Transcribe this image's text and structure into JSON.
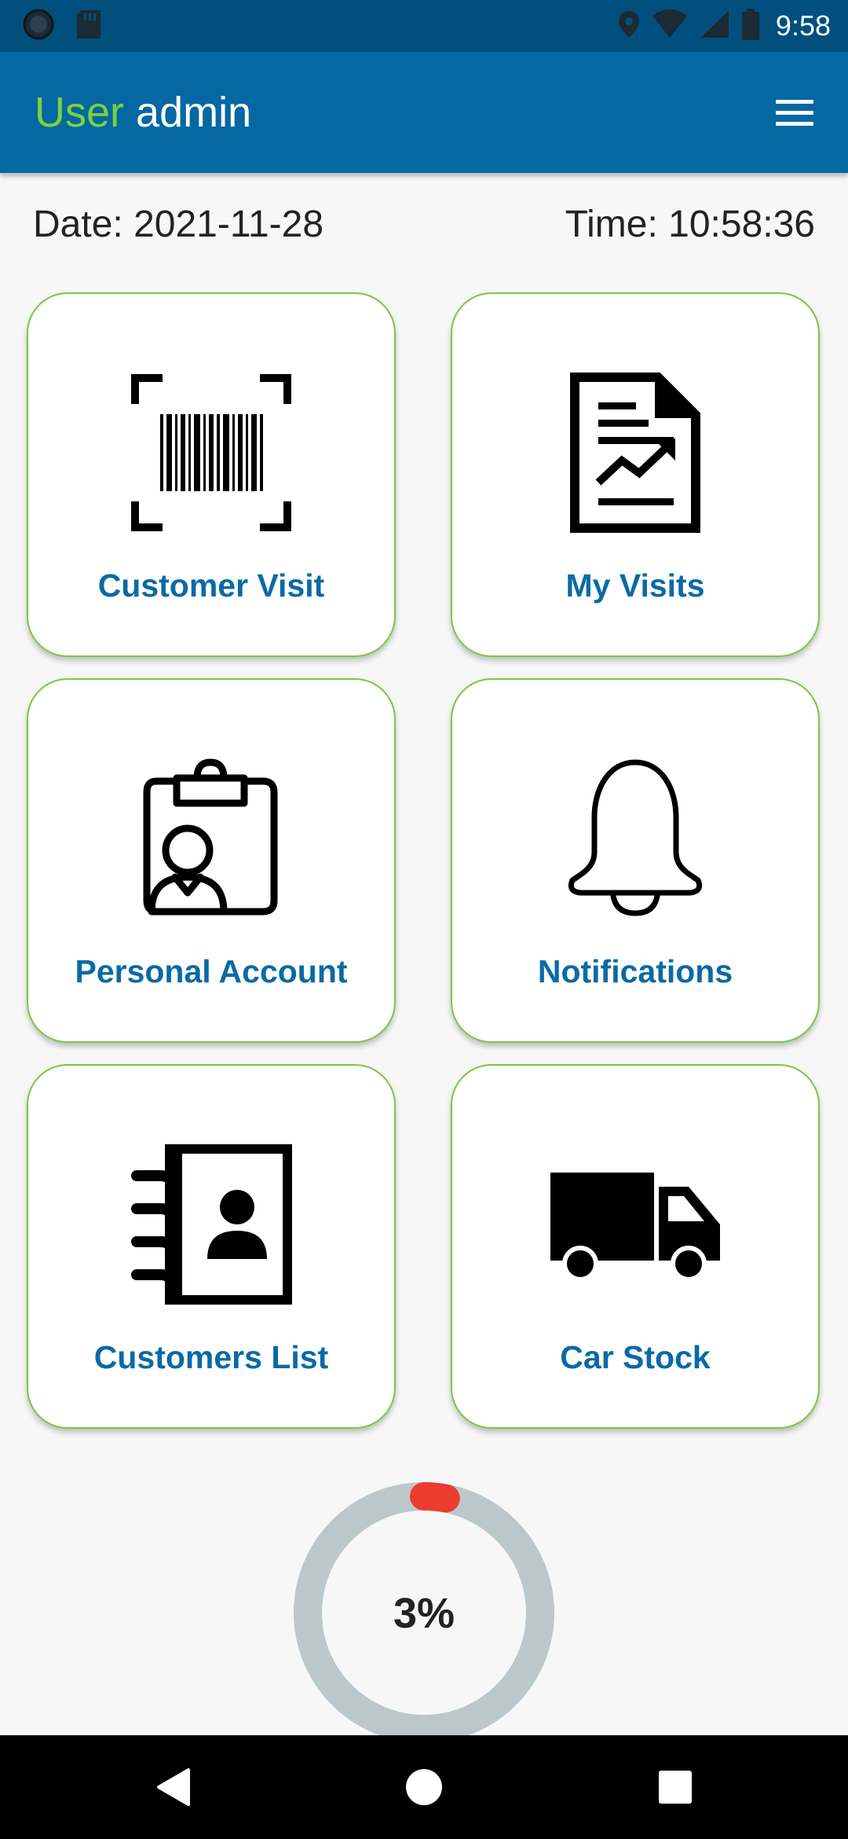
{
  "status_bar": {
    "time": "9:58",
    "left_icons": [
      "app-notification-icon",
      "sd-card-icon"
    ],
    "right_icons": [
      "location-icon",
      "wifi-icon",
      "signal-icon",
      "battery-icon"
    ]
  },
  "app_bar": {
    "title_prefix": "User",
    "title_user": "admin",
    "menu_icon": "hamburger-menu-icon"
  },
  "info": {
    "date": "Date: 2021-11-28",
    "time": "Time: 10:58:36"
  },
  "tiles": [
    {
      "label": "Customer Visit",
      "icon": "barcode-scan-icon"
    },
    {
      "label": "My Visits",
      "icon": "report-chart-icon"
    },
    {
      "label": "Personal Account",
      "icon": "clipboard-user-icon"
    },
    {
      "label": "Notifications",
      "icon": "bell-icon"
    },
    {
      "label": "Customers List",
      "icon": "contact-book-icon"
    },
    {
      "label": "Car Stock",
      "icon": "truck-icon"
    }
  ],
  "progress": {
    "label": "3%",
    "value": 0.03
  },
  "colors": {
    "status_bar": "#004f7c",
    "app_bar": "#0568a3",
    "accent_green": "#7bc843",
    "title_green": "#7bd23b",
    "tile_label": "#0a6aa5",
    "ring_track": "#bcc7cc",
    "ring_progress": "#ee3b30"
  },
  "nav_bar": {
    "buttons": [
      "back-icon",
      "home-icon",
      "recents-icon"
    ]
  }
}
